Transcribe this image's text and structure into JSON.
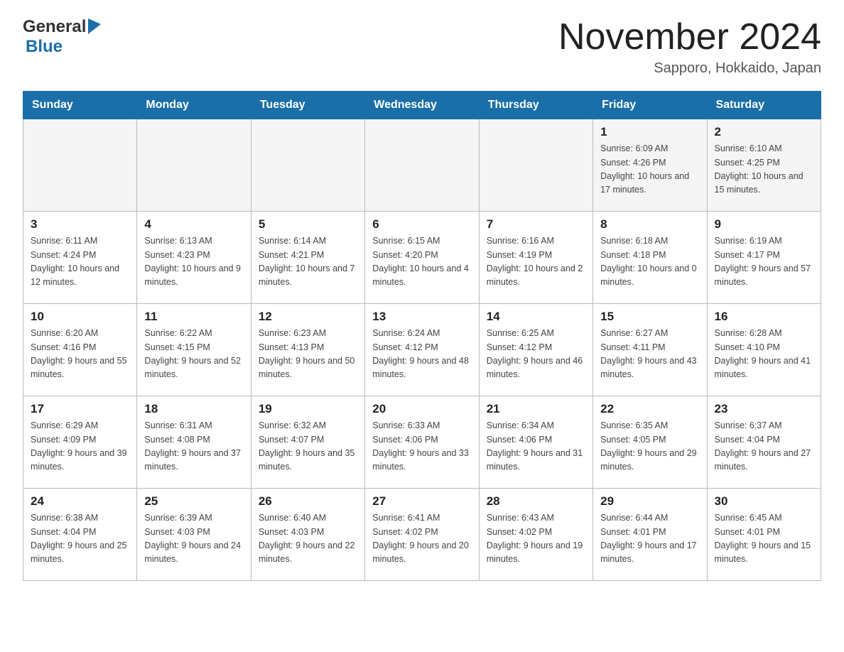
{
  "logo": {
    "text_general": "General",
    "text_blue": "Blue",
    "triangle": "▶"
  },
  "header": {
    "month_title": "November 2024",
    "location": "Sapporo, Hokkaido, Japan"
  },
  "days_of_week": [
    "Sunday",
    "Monday",
    "Tuesday",
    "Wednesday",
    "Thursday",
    "Friday",
    "Saturday"
  ],
  "weeks": [
    [
      {
        "day": "",
        "info": ""
      },
      {
        "day": "",
        "info": ""
      },
      {
        "day": "",
        "info": ""
      },
      {
        "day": "",
        "info": ""
      },
      {
        "day": "",
        "info": ""
      },
      {
        "day": "1",
        "info": "Sunrise: 6:09 AM\nSunset: 4:26 PM\nDaylight: 10 hours\nand 17 minutes."
      },
      {
        "day": "2",
        "info": "Sunrise: 6:10 AM\nSunset: 4:25 PM\nDaylight: 10 hours\nand 15 minutes."
      }
    ],
    [
      {
        "day": "3",
        "info": "Sunrise: 6:11 AM\nSunset: 4:24 PM\nDaylight: 10 hours\nand 12 minutes."
      },
      {
        "day": "4",
        "info": "Sunrise: 6:13 AM\nSunset: 4:23 PM\nDaylight: 10 hours\nand 9 minutes."
      },
      {
        "day": "5",
        "info": "Sunrise: 6:14 AM\nSunset: 4:21 PM\nDaylight: 10 hours\nand 7 minutes."
      },
      {
        "day": "6",
        "info": "Sunrise: 6:15 AM\nSunset: 4:20 PM\nDaylight: 10 hours\nand 4 minutes."
      },
      {
        "day": "7",
        "info": "Sunrise: 6:16 AM\nSunset: 4:19 PM\nDaylight: 10 hours\nand 2 minutes."
      },
      {
        "day": "8",
        "info": "Sunrise: 6:18 AM\nSunset: 4:18 PM\nDaylight: 10 hours\nand 0 minutes."
      },
      {
        "day": "9",
        "info": "Sunrise: 6:19 AM\nSunset: 4:17 PM\nDaylight: 9 hours\nand 57 minutes."
      }
    ],
    [
      {
        "day": "10",
        "info": "Sunrise: 6:20 AM\nSunset: 4:16 PM\nDaylight: 9 hours\nand 55 minutes."
      },
      {
        "day": "11",
        "info": "Sunrise: 6:22 AM\nSunset: 4:15 PM\nDaylight: 9 hours\nand 52 minutes."
      },
      {
        "day": "12",
        "info": "Sunrise: 6:23 AM\nSunset: 4:13 PM\nDaylight: 9 hours\nand 50 minutes."
      },
      {
        "day": "13",
        "info": "Sunrise: 6:24 AM\nSunset: 4:12 PM\nDaylight: 9 hours\nand 48 minutes."
      },
      {
        "day": "14",
        "info": "Sunrise: 6:25 AM\nSunset: 4:12 PM\nDaylight: 9 hours\nand 46 minutes."
      },
      {
        "day": "15",
        "info": "Sunrise: 6:27 AM\nSunset: 4:11 PM\nDaylight: 9 hours\nand 43 minutes."
      },
      {
        "day": "16",
        "info": "Sunrise: 6:28 AM\nSunset: 4:10 PM\nDaylight: 9 hours\nand 41 minutes."
      }
    ],
    [
      {
        "day": "17",
        "info": "Sunrise: 6:29 AM\nSunset: 4:09 PM\nDaylight: 9 hours\nand 39 minutes."
      },
      {
        "day": "18",
        "info": "Sunrise: 6:31 AM\nSunset: 4:08 PM\nDaylight: 9 hours\nand 37 minutes."
      },
      {
        "day": "19",
        "info": "Sunrise: 6:32 AM\nSunset: 4:07 PM\nDaylight: 9 hours\nand 35 minutes."
      },
      {
        "day": "20",
        "info": "Sunrise: 6:33 AM\nSunset: 4:06 PM\nDaylight: 9 hours\nand 33 minutes."
      },
      {
        "day": "21",
        "info": "Sunrise: 6:34 AM\nSunset: 4:06 PM\nDaylight: 9 hours\nand 31 minutes."
      },
      {
        "day": "22",
        "info": "Sunrise: 6:35 AM\nSunset: 4:05 PM\nDaylight: 9 hours\nand 29 minutes."
      },
      {
        "day": "23",
        "info": "Sunrise: 6:37 AM\nSunset: 4:04 PM\nDaylight: 9 hours\nand 27 minutes."
      }
    ],
    [
      {
        "day": "24",
        "info": "Sunrise: 6:38 AM\nSunset: 4:04 PM\nDaylight: 9 hours\nand 25 minutes."
      },
      {
        "day": "25",
        "info": "Sunrise: 6:39 AM\nSunset: 4:03 PM\nDaylight: 9 hours\nand 24 minutes."
      },
      {
        "day": "26",
        "info": "Sunrise: 6:40 AM\nSunset: 4:03 PM\nDaylight: 9 hours\nand 22 minutes."
      },
      {
        "day": "27",
        "info": "Sunrise: 6:41 AM\nSunset: 4:02 PM\nDaylight: 9 hours\nand 20 minutes."
      },
      {
        "day": "28",
        "info": "Sunrise: 6:43 AM\nSunset: 4:02 PM\nDaylight: 9 hours\nand 19 minutes."
      },
      {
        "day": "29",
        "info": "Sunrise: 6:44 AM\nSunset: 4:01 PM\nDaylight: 9 hours\nand 17 minutes."
      },
      {
        "day": "30",
        "info": "Sunrise: 6:45 AM\nSunset: 4:01 PM\nDaylight: 9 hours\nand 15 minutes."
      }
    ]
  ]
}
